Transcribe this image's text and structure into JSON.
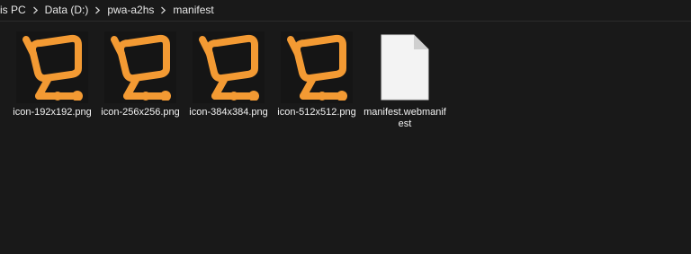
{
  "breadcrumb": {
    "items": [
      "is PC",
      "Data (D:)",
      "pwa-a2hs",
      "manifest"
    ]
  },
  "colors": {
    "background": "#191919",
    "icon_orange": "#F39A33",
    "document_white": "#F3F3F3"
  },
  "files": [
    {
      "name": "icon-192x192.png",
      "icon": "cart-logo-icon"
    },
    {
      "name": "icon-256x256.png",
      "icon": "cart-logo-icon"
    },
    {
      "name": "icon-384x384.png",
      "icon": "cart-logo-icon"
    },
    {
      "name": "icon-512x512.png",
      "icon": "cart-logo-icon"
    },
    {
      "name": "manifest.webmanifest",
      "icon": "blank-document-icon"
    }
  ]
}
